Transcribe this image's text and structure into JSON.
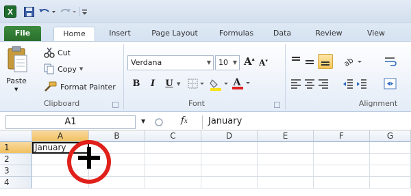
{
  "tabs": [
    "File",
    "Home",
    "Insert",
    "Page Layout",
    "Formulas",
    "Data",
    "Review",
    "View"
  ],
  "clipboard": {
    "paste": "Paste",
    "cut": "Cut",
    "copy": "Copy",
    "format_painter": "Format Painter",
    "group_label": "Clipboard"
  },
  "font": {
    "name": "Verdana",
    "size": "10",
    "group_label": "Font",
    "bold": "B",
    "italic": "I",
    "underline": "U"
  },
  "alignment": {
    "group_label": "Alignment"
  },
  "formula_bar": {
    "name_box": "A1",
    "fx": "fx",
    "value": "January"
  },
  "grid": {
    "columns": [
      "A",
      "B",
      "C",
      "D",
      "E",
      "F",
      "G"
    ],
    "rows": [
      "1",
      "2",
      "3",
      "4"
    ],
    "cells": {
      "A1": "January"
    }
  },
  "annotation": {
    "color": "#e0201a",
    "cursor": "plus-cursor-icon"
  }
}
